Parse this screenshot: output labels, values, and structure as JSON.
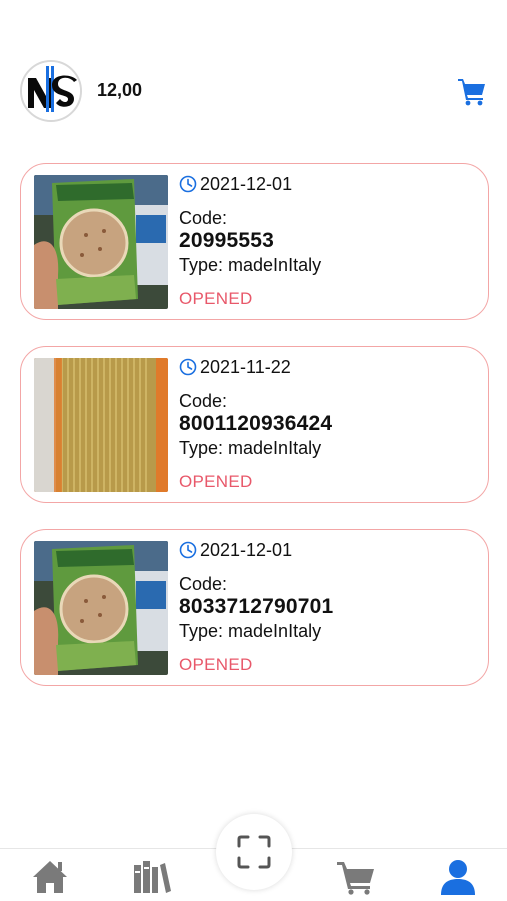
{
  "header": {
    "logo_icon": "brand-logo-icon",
    "balance": "12,00",
    "cart_icon": "cart-icon",
    "accent_color": "#1a6fe0"
  },
  "items": [
    {
      "date": "2021-12-01",
      "code_label": "Code:",
      "code": "20995553",
      "type": "Type: madeInItaly",
      "status": "OPENED",
      "thumb": "rice-bag-photo"
    },
    {
      "date": "2021-11-22",
      "code_label": "Code:",
      "code": "8001120936424",
      "type": "Type: madeInItaly",
      "status": "OPENED",
      "thumb": "spaghetti-photo"
    },
    {
      "date": "2021-12-01",
      "code_label": "Code:",
      "code": "8033712790701",
      "type": "Type: madeInItaly",
      "status": "OPENED",
      "thumb": "rice-bag-photo"
    }
  ],
  "nav": {
    "items": [
      "home-icon",
      "library-icon",
      "scan-icon",
      "cart-icon",
      "profile-icon"
    ],
    "active": "profile-icon",
    "inactive_color": "#7a7a7a",
    "active_color": "#1a6fe0"
  },
  "colors": {
    "status": "#e8586a",
    "card_border": "#f3a6a6",
    "clock": "#1a6fe0"
  }
}
